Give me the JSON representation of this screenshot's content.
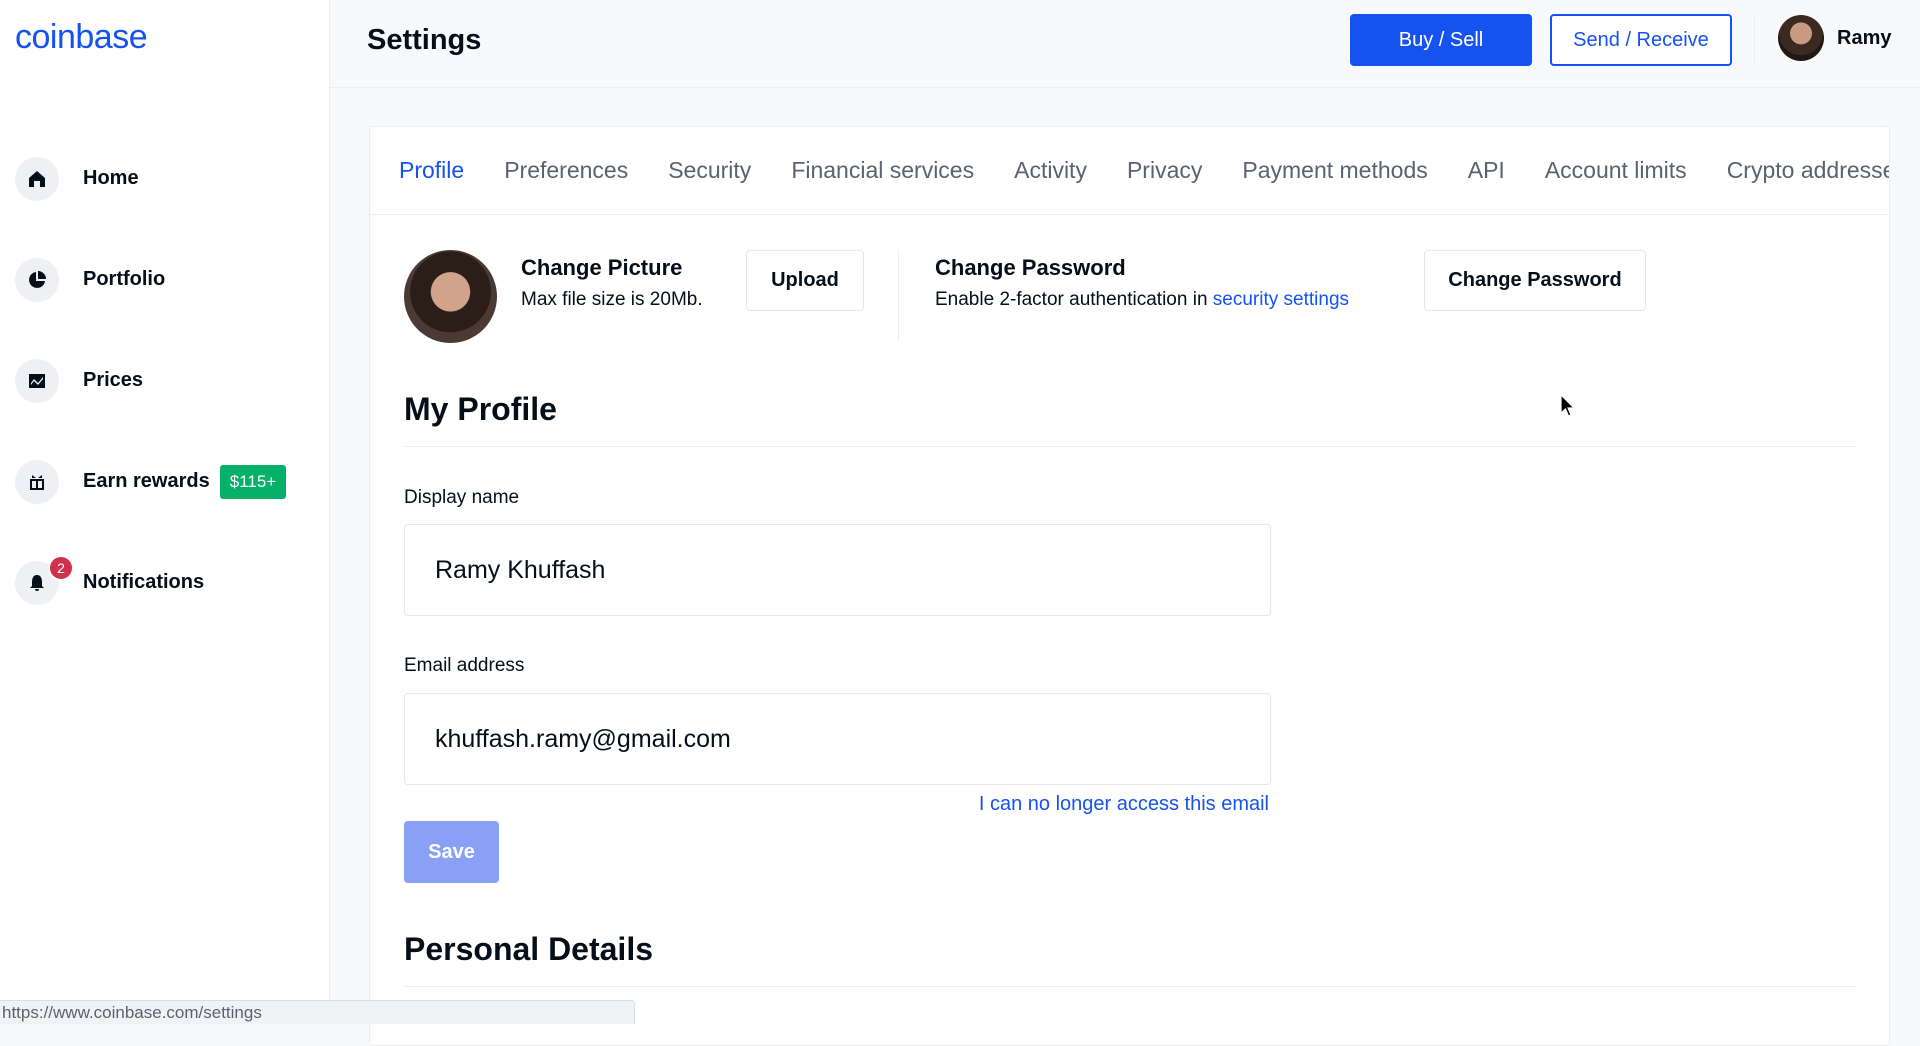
{
  "brand": {
    "logo_text": "coinbase",
    "accent_color": "#1652F0"
  },
  "sidebar": {
    "items": [
      {
        "label": "Home",
        "icon": "home-icon"
      },
      {
        "label": "Portfolio",
        "icon": "pie-chart-icon"
      },
      {
        "label": "Prices",
        "icon": "chart-line-icon"
      },
      {
        "label": "Earn rewards",
        "icon": "gift-icon",
        "badge": "$115+"
      },
      {
        "label": "Notifications",
        "icon": "bell-icon",
        "count": "2"
      }
    ]
  },
  "header": {
    "title": "Settings",
    "buy_sell_label": "Buy / Sell",
    "send_receive_label": "Send / Receive",
    "user_name": "Ramy"
  },
  "tabs": [
    {
      "label": "Profile",
      "active": true
    },
    {
      "label": "Preferences"
    },
    {
      "label": "Security"
    },
    {
      "label": "Financial services"
    },
    {
      "label": "Activity"
    },
    {
      "label": "Privacy"
    },
    {
      "label": "Payment methods"
    },
    {
      "label": "API"
    },
    {
      "label": "Account limits"
    },
    {
      "label": "Crypto addresses"
    }
  ],
  "picture": {
    "title": "Change Picture",
    "subtitle": "Max file size is 20Mb.",
    "upload_label": "Upload"
  },
  "password": {
    "title": "Change Password",
    "subtitle_prefix": "Enable 2-factor authentication in ",
    "subtitle_link": "security settings",
    "button_label": "Change Password"
  },
  "my_profile": {
    "title": "My Profile",
    "display_name_label": "Display name",
    "display_name_value": "Ramy Khuffash",
    "email_label": "Email address",
    "email_value": "khuffash.ramy@gmail.com",
    "email_help_link": "I can no longer access this email",
    "save_label": "Save"
  },
  "personal_details": {
    "title": "Personal Details"
  },
  "status_bar": {
    "url": "https://www.coinbase.com/settings"
  }
}
